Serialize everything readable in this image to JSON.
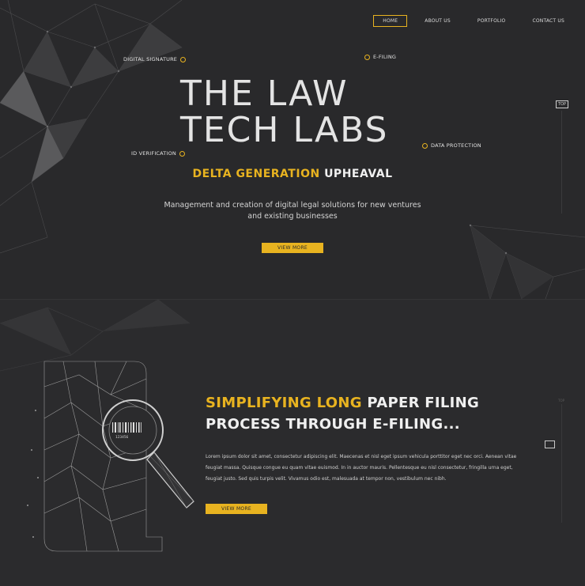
{
  "nav": {
    "items": [
      {
        "label": "HOME",
        "active": true
      },
      {
        "label": "ABOUT US",
        "active": false
      },
      {
        "label": "PORTFOLIO",
        "active": false
      },
      {
        "label": "CONTACT US",
        "active": false
      }
    ]
  },
  "hero": {
    "title_line1": "THE LAW",
    "title_line2": "TECH LABS",
    "labels": {
      "digital_signature": "DIGITAL SIGNATURE",
      "e_filing": "E-FILING",
      "id_verification": "ID VERIFICATION",
      "data_protection": "DATA PROTECTION"
    },
    "subtitle_highlight": "DELTA GENERATION",
    "subtitle_rest": "UPHEAVAL",
    "description_line1": "Management and creation of digital legal solutions for new ventures",
    "description_line2": "and existing businesses",
    "button_label": "VIEW MORE",
    "top_label": "TOP"
  },
  "section2": {
    "heading_highlight": "SIMPLIFYING LONG",
    "heading_rest_line1": "PAPER FILING",
    "heading_line2": "PROCESS THROUGH E-FILING...",
    "paragraph": "Lorem ipsum dolor sit amet, consectetur adipiscing elit. Maecenas et nisl eget ipsum vehicula porttitor eget nec orci. Aenean vitae feugiat massa. Quisque congue eu quam vitae euismod. In in auctor mauris. Pellentesque eu nisl consectetur, fringilla urna eget, feugiat justo. Sed quis turpis velit. Vivamus odio est, malesuada at tempor non, vestibulum nec nibh.",
    "button_label": "VIEW MORE",
    "barcode_number": "123456",
    "side_top_label": "TOP"
  },
  "colors": {
    "accent": "#e8b320",
    "background": "#29292b",
    "text": "#e6e6e6"
  }
}
